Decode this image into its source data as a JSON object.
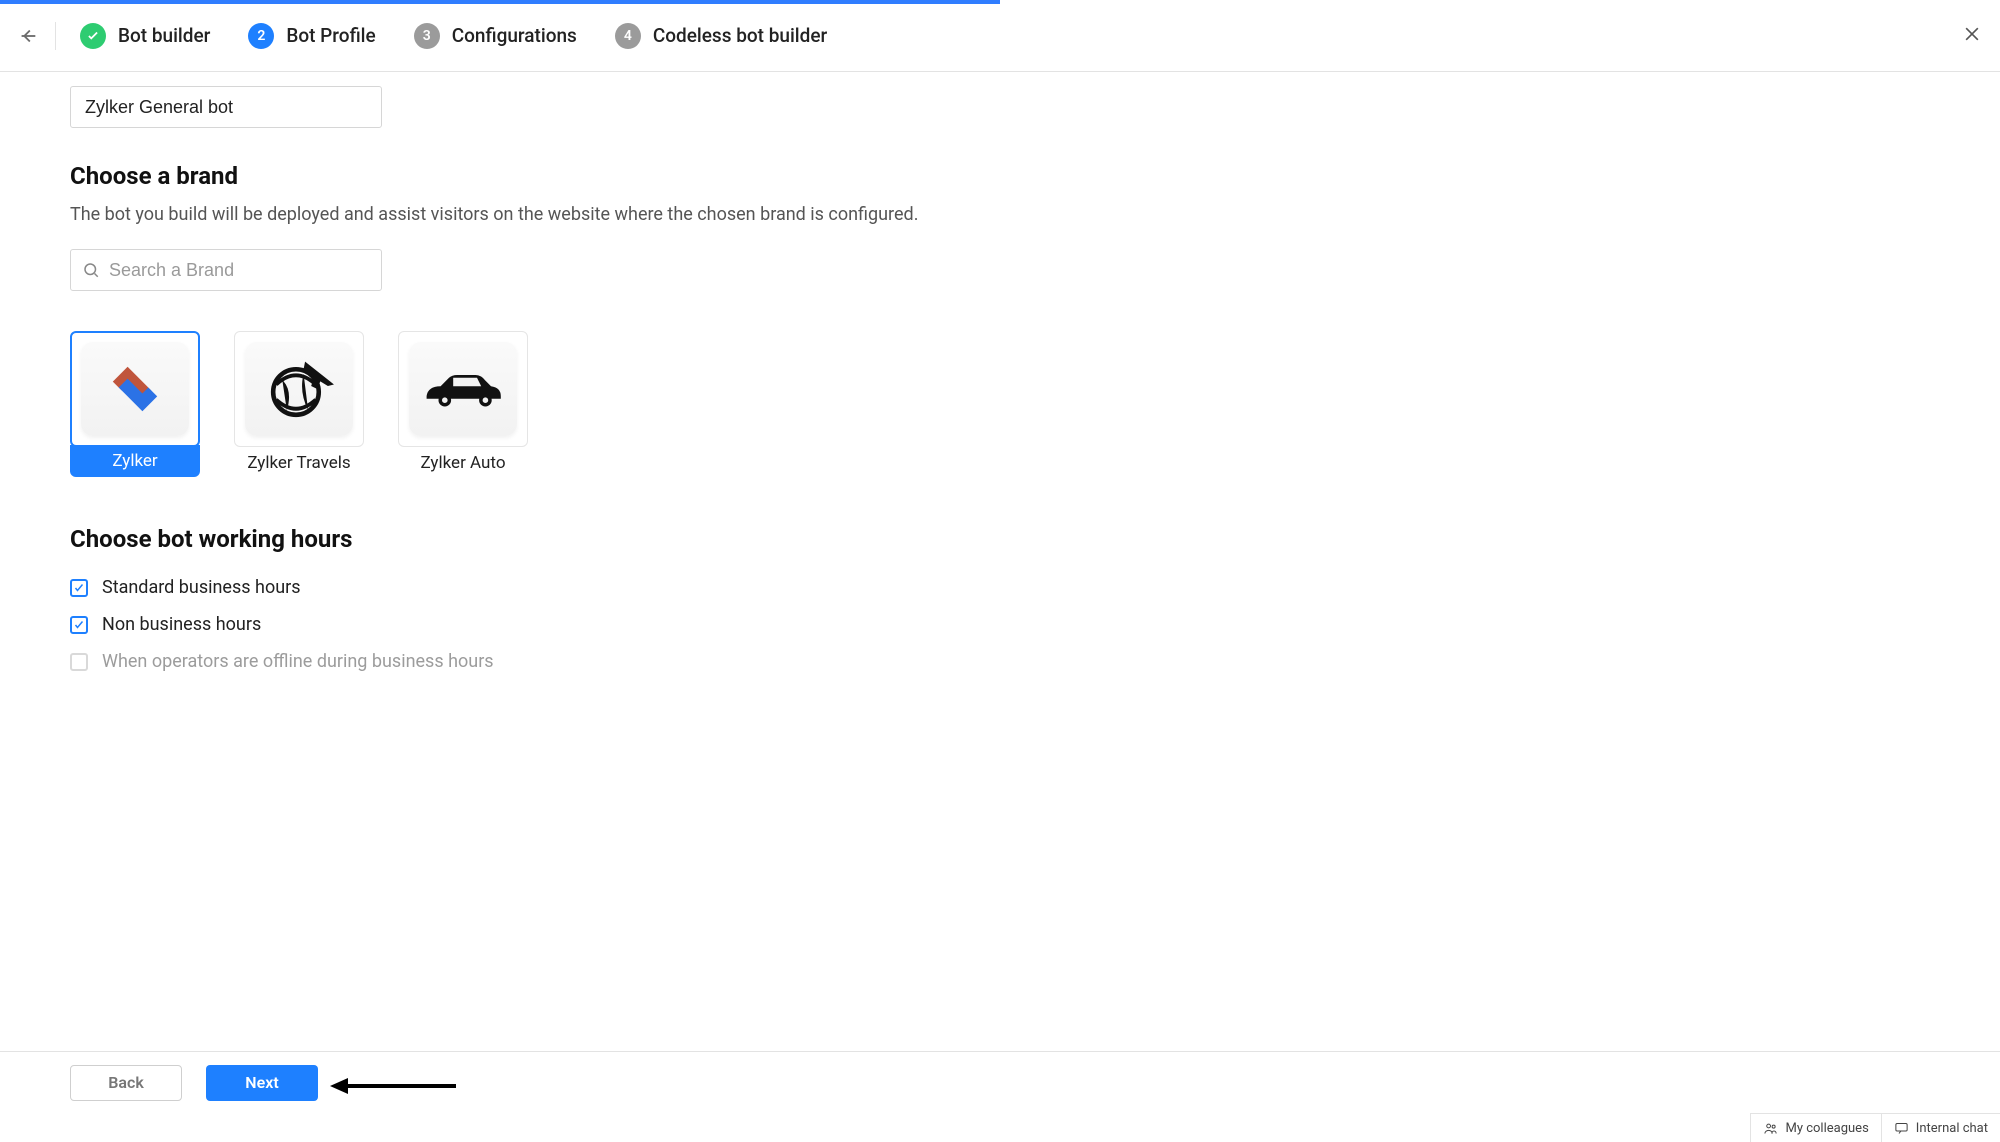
{
  "steps": [
    {
      "label": "Bot builder",
      "state": "done",
      "badge": "✓"
    },
    {
      "label": "Bot Profile",
      "state": "active",
      "badge": "2"
    },
    {
      "label": "Configurations",
      "state": "todo",
      "badge": "3"
    },
    {
      "label": "Codeless bot builder",
      "state": "todo",
      "badge": "4"
    }
  ],
  "bot_name_input": {
    "value": "Zylker General bot"
  },
  "brand_section": {
    "title": "Choose a brand",
    "subtitle": "The bot you build will be deployed and assist visitors on the website where the chosen brand is configured.",
    "search_placeholder": "Search a Brand",
    "brands": [
      {
        "label": "Zylker",
        "selected": true,
        "icon": "zylker"
      },
      {
        "label": "Zylker Travels",
        "selected": false,
        "icon": "globe-plane"
      },
      {
        "label": "Zylker Auto",
        "selected": false,
        "icon": "car"
      }
    ]
  },
  "hours_section": {
    "title": "Choose bot working hours",
    "options": [
      {
        "label": "Standard business hours",
        "checked": true,
        "disabled": false
      },
      {
        "label": "Non business hours",
        "checked": true,
        "disabled": false
      },
      {
        "label": "When operators are offline during business hours",
        "checked": false,
        "disabled": true
      }
    ]
  },
  "footer": {
    "back": "Back",
    "next": "Next"
  },
  "bottom_bar": {
    "colleagues": "My colleagues",
    "internal_chat": "Internal chat"
  }
}
